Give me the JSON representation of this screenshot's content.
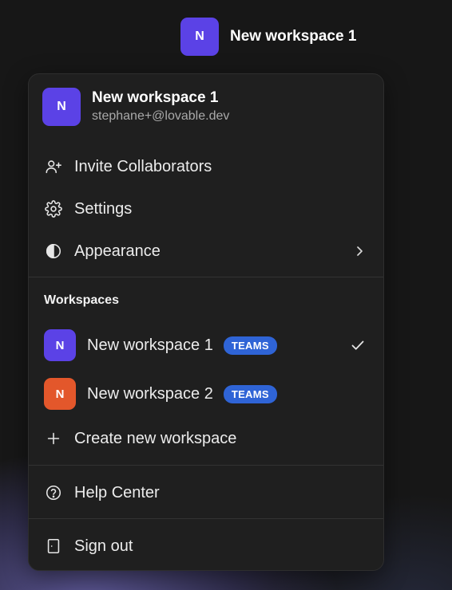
{
  "topbar": {
    "avatar_letter": "N",
    "workspace_name": "New workspace 1",
    "avatar_color": "#5b42e6"
  },
  "menu": {
    "header": {
      "avatar_letter": "N",
      "workspace_name": "New workspace 1",
      "email": "stephane+@lovable.dev",
      "avatar_color": "#5b42e6"
    },
    "items": {
      "invite": {
        "label": "Invite Collaborators",
        "icon": "user-plus-icon"
      },
      "settings": {
        "label": "Settings",
        "icon": "gear-icon"
      },
      "appearance": {
        "label": "Appearance",
        "icon": "contrast-icon"
      }
    },
    "workspaces_title": "Workspaces",
    "workspaces": [
      {
        "avatar_letter": "N",
        "name": "New workspace 1",
        "badge": "TEAMS",
        "avatar_color": "#5b42e6",
        "selected": true
      },
      {
        "avatar_letter": "N",
        "name": "New workspace 2",
        "badge": "TEAMS",
        "avatar_color": "#e3572b",
        "selected": false
      }
    ],
    "create_workspace": {
      "label": "Create new workspace",
      "icon": "plus-icon"
    },
    "help": {
      "label": "Help Center",
      "icon": "help-circle-icon"
    },
    "signout": {
      "label": "Sign out",
      "icon": "door-icon"
    },
    "badge_color": "#2f64d6"
  }
}
